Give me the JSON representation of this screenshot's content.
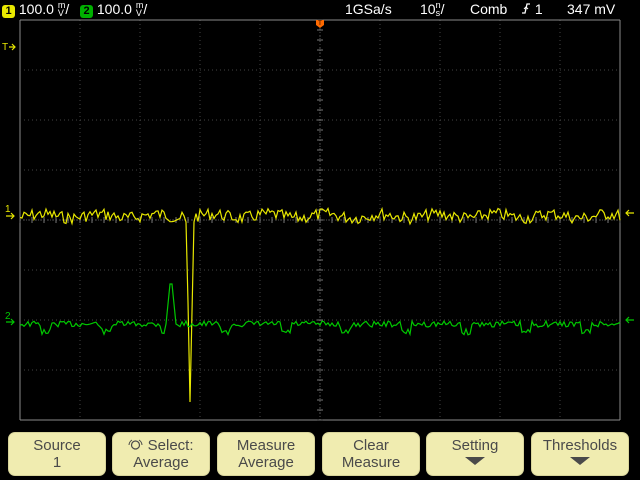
{
  "status_bar": {
    "ch1_number": "1",
    "ch1_scale": "100.0",
    "ch1_unit_top": "m",
    "ch1_unit_bottom": "V",
    "ch2_number": "2",
    "ch2_scale": "100.0",
    "ch2_unit_top": "m",
    "ch2_unit_bottom": "V",
    "sample_rate": "1GSa/s",
    "timebase": "10",
    "timebase_unit_top": "n",
    "timebase_unit_bottom": "s",
    "acq_mode": "Comb",
    "trigger_source": "1",
    "trigger_level": "347 mV"
  },
  "markers": {
    "ch1_label": "1",
    "ch2_label": "2",
    "trigger_marker": "T"
  },
  "colors": {
    "ch1": "#e8e800",
    "ch2": "#00c800",
    "grid": "#8a8a8a",
    "softkey_bg": "#f0ecb0"
  },
  "softkeys": [
    {
      "line1": "Source",
      "line2": "1",
      "arrow": false
    },
    {
      "line1": "Select:",
      "line2": "Average",
      "arrow": false,
      "icon": "knob-select-icon"
    },
    {
      "line1": "Measure",
      "line2": "Average",
      "arrow": false
    },
    {
      "line1": "Clear",
      "line2": "Measure",
      "arrow": false
    },
    {
      "line1": "Setting",
      "line2": "",
      "arrow": true
    },
    {
      "line1": "Thresholds",
      "line2": "",
      "arrow": true
    }
  ]
}
